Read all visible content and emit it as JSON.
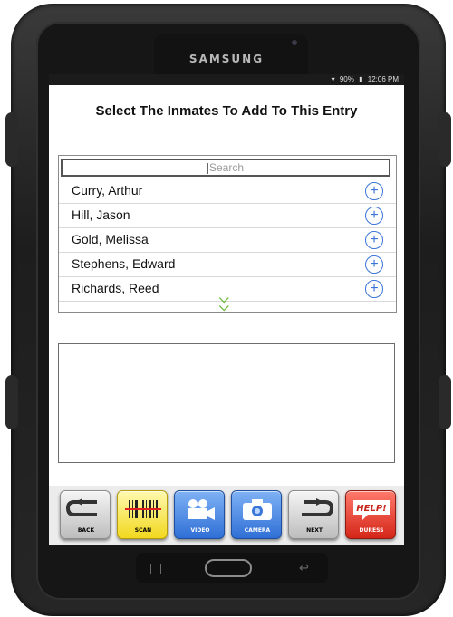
{
  "device": {
    "brand": "SAMSUNG"
  },
  "statusbar": {
    "battery": "90%",
    "time": "12:06 PM"
  },
  "header": {
    "title": "Select The Inmates To Add To This Entry"
  },
  "search": {
    "placeholder": "Search"
  },
  "inmates": [
    {
      "name": "Curry, Arthur"
    },
    {
      "name": "Hill, Jason"
    },
    {
      "name": "Gold, Melissa"
    },
    {
      "name": "Stephens, Edward"
    },
    {
      "name": "Richards, Reed"
    }
  ],
  "toolbar": {
    "back_label": "BACK",
    "scan_label": "SCAN",
    "video_label": "VIDEO",
    "camera_label": "CAMERA",
    "next_label": "NEXT",
    "duress_label": "DURESS",
    "help_text": "HELP!"
  },
  "colors": {
    "accent_blue": "#3a74d8",
    "expand_green": "#66b832",
    "duress_red": "#d42618",
    "scan_yellow": "#f2d81e"
  }
}
